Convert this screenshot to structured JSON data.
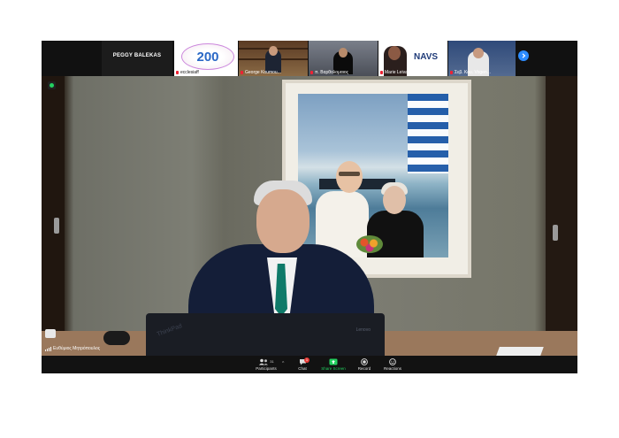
{
  "thumbnails": [
    {
      "label": "",
      "display_name": "PEGGY BALEKAS"
    },
    {
      "label": "ecclesiaff",
      "logo_text": "200"
    },
    {
      "label": "George Koumou..."
    },
    {
      "label": "π. Βαρθολομαιος"
    },
    {
      "label": "Marie Leivatou",
      "brand": "NAVS"
    },
    {
      "label": "Σεβ. Κου. Vogen..."
    }
  ],
  "speaker": {
    "name": "Ευθύμιος Μητρόπουλος"
  },
  "laptop": {
    "brand": "ThinkPad",
    "brand2": "Lenovo"
  },
  "toolbar": {
    "participants": {
      "label": "Participants",
      "count": "31"
    },
    "chat": {
      "label": "Chat",
      "badge": "1"
    },
    "share": {
      "label": "Share Screen"
    },
    "record": {
      "label": "Record"
    },
    "reactions": {
      "label": "Reactions"
    }
  },
  "colors": {
    "accent": "#2d8cff",
    "share_green": "#23d160",
    "badge_red": "#e53935",
    "toolbar_bg": "#121212"
  }
}
